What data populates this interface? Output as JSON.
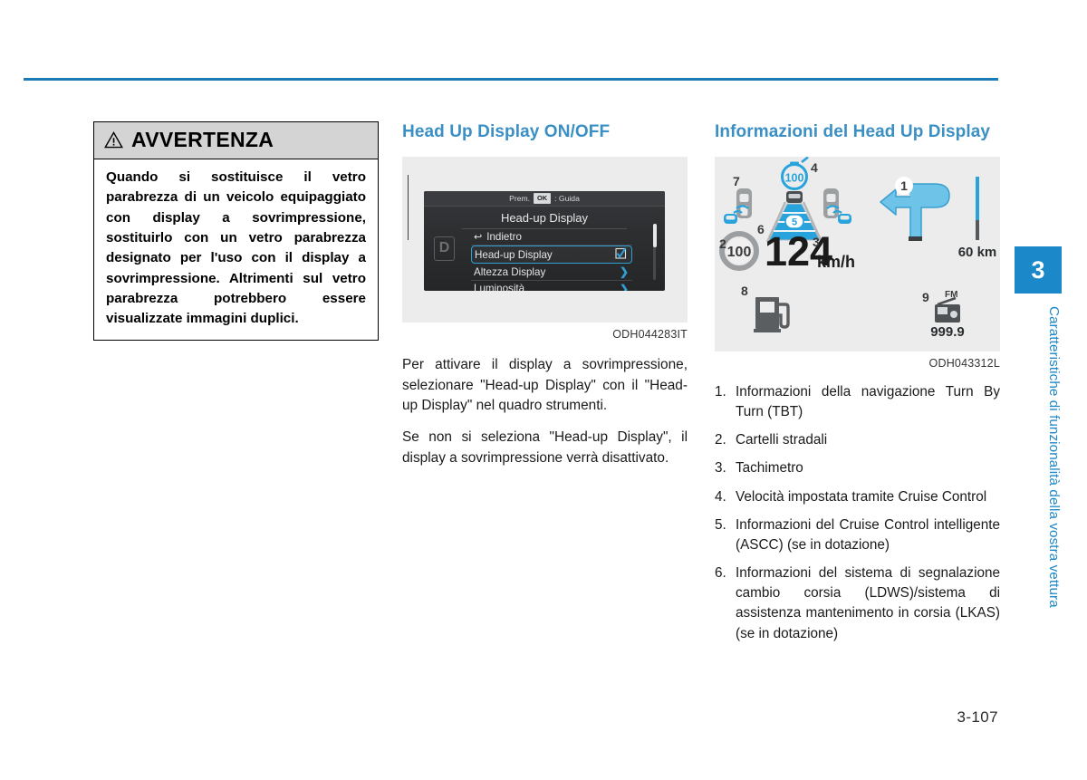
{
  "page": {
    "number": "3-107",
    "side_tab": {
      "chapter": "3",
      "title": "Caratteristiche di funzionalità della vostra vettura",
      "accent": "#1b88c9"
    }
  },
  "warning": {
    "title": "AVVERTENZA",
    "icon": "warning-triangle-icon",
    "text": "Quando si sostituisce il vetro parabrezza di un veicolo equipaggiato con display a sovrimpressione, sostituirlo con un vetro parabrezza designato per l'uso con il display a sovrimpressione. Altrimenti sul vetro parabrezza potrebbero essere visualizzate immagini duplici."
  },
  "middle": {
    "heading": "Head Up Display ON/OFF",
    "figure_caption": "ODH044283IT",
    "cluster": {
      "hint_prefix": "Prem.",
      "hint_key": "OK",
      "hint_suffix": ": Guida",
      "title": "Head-up Display",
      "gear_badge": "D",
      "rows": [
        {
          "label": "Indietro",
          "glyph": "back-arrow-icon",
          "control": "none",
          "selected": false
        },
        {
          "label": "Head-up Display",
          "glyph": "",
          "control": "checkbox-checked",
          "selected": true
        },
        {
          "label": "Altezza Display",
          "glyph": "",
          "control": "chevron-right",
          "selected": false
        },
        {
          "label": "Luminosità",
          "glyph": "",
          "control": "chevron-right",
          "selected": false
        }
      ]
    },
    "paragraphs": [
      "Per attivare il display a sovrimpressione, selezionare \"Head-up Display\" con il \"Head-up Display\" nel quadro strumenti.",
      "Se non si seleziona \"Head-up Display\", il display a sovrimpressione verrà disattivato."
    ]
  },
  "right": {
    "heading": "Informazioni del Head Up Display",
    "figure_caption": "ODH043312L",
    "hud": {
      "accent": "#29a3dc",
      "speed_value": "124",
      "speed_unit": "km/h",
      "speed_limit_sign": "100",
      "cruise_set_speed": "100",
      "nav_distance": "60 km",
      "radio_band": "FM",
      "radio_frequency": "999.9",
      "callouts": [
        "1",
        "2",
        "3",
        "4",
        "5",
        "6",
        "7",
        "8",
        "9"
      ]
    },
    "list": [
      {
        "num": "1.",
        "text": "Informazioni della navigazione Turn By Turn (TBT)"
      },
      {
        "num": "2.",
        "text": "Cartelli stradali"
      },
      {
        "num": "3.",
        "text": "Tachimetro"
      },
      {
        "num": "4.",
        "text": "Velocità impostata tramite Cruise Control"
      },
      {
        "num": "5.",
        "text": "Informazioni del Cruise Control intelligente (ASCC) (se in dotazione)"
      },
      {
        "num": "6.",
        "text": "Informazioni del sistema di segnalazione cambio corsia (LDWS)/sistema di assistenza mantenimento in corsia (LKAS) (se in dotazione)"
      }
    ]
  }
}
